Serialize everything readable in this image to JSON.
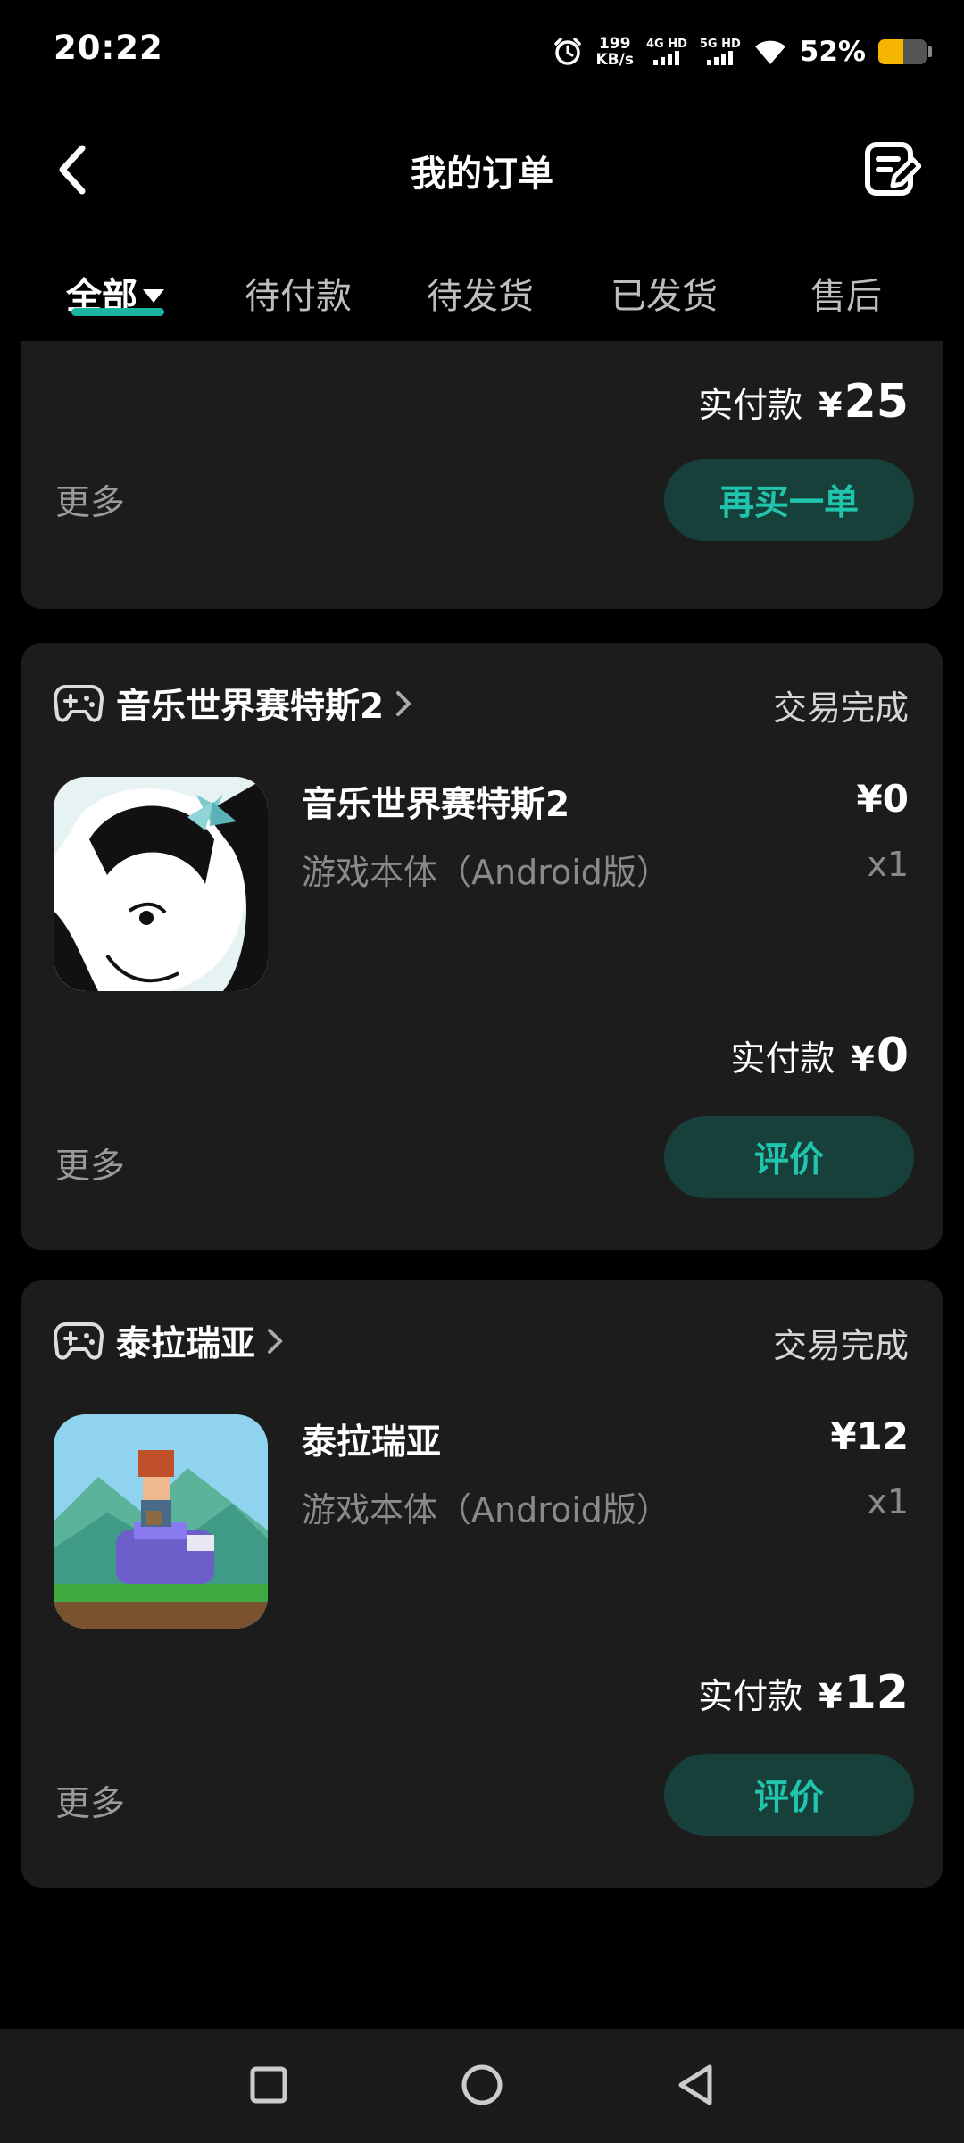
{
  "status_bar": {
    "time": "20:22",
    "net_speed_value": "199",
    "net_speed_unit": "KB/s",
    "sim1_label": "4G HD",
    "sim2_label": "5G HD",
    "battery_percent": "52%",
    "battery_level": 0.52,
    "battery_color": "#f5b400"
  },
  "header": {
    "title": "我的订单",
    "back_icon": "chevron-left-icon",
    "edit_icon": "edit-note-icon"
  },
  "tabs": [
    {
      "label": "全部",
      "active": true
    },
    {
      "label": "待付款",
      "active": false
    },
    {
      "label": "待发货",
      "active": false
    },
    {
      "label": "已发货",
      "active": false
    },
    {
      "label": "售后",
      "active": false
    }
  ],
  "accent_color": "#1bb5a2",
  "orders": [
    {
      "paid_label": "实付款",
      "paid_currency": "¥",
      "paid_amount": "25",
      "more_label": "更多",
      "action_label": "再买一单"
    },
    {
      "shop_name": "音乐世界赛特斯2",
      "status": "交易完成",
      "item_name": "音乐世界赛特斯2",
      "item_spec": "游戏本体（Android版）",
      "item_price": "¥0",
      "item_qty": "x1",
      "paid_label": "实付款",
      "paid_currency": "¥",
      "paid_amount": "0",
      "more_label": "更多",
      "action_label": "评价"
    },
    {
      "shop_name": "泰拉瑞亚",
      "status": "交易完成",
      "item_name": "泰拉瑞亚",
      "item_spec": "游戏本体（Android版）",
      "item_price": "¥12",
      "item_qty": "x1",
      "paid_label": "实付款",
      "paid_currency": "¥",
      "paid_amount": "12",
      "more_label": "更多",
      "action_label": "评价"
    }
  ],
  "nav_bar": {
    "recent_icon": "square-icon",
    "home_icon": "circle-icon",
    "back_icon": "triangle-back-icon"
  }
}
